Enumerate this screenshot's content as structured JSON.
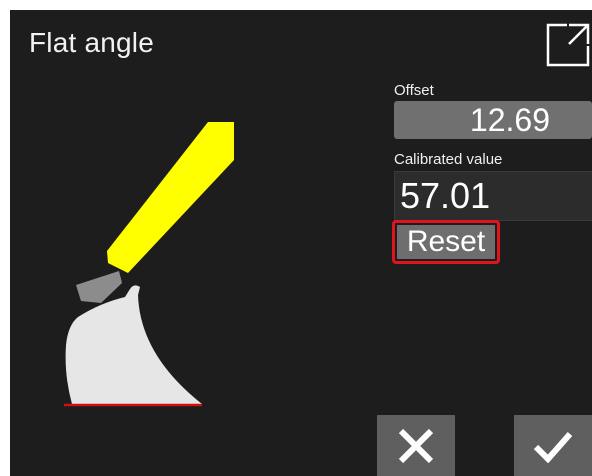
{
  "header": {
    "title": "Flat angle",
    "expand_icon": "open-external-icon"
  },
  "fields": {
    "offset_label": "Offset",
    "offset_value": "12.69",
    "calibrated_label": "Calibrated value",
    "calibrated_value": "57.01",
    "reset_label": "Reset"
  },
  "actions": {
    "cancel_icon": "close-icon",
    "confirm_icon": "check-icon"
  },
  "colors": {
    "background": "#1d1d1d",
    "arm": "#ffff00",
    "bucket": "#e6e6e6",
    "link": "#8c8c8c",
    "ground_line": "#cc1111",
    "reset_border": "#e0141e",
    "button": "#5f5f5f"
  }
}
